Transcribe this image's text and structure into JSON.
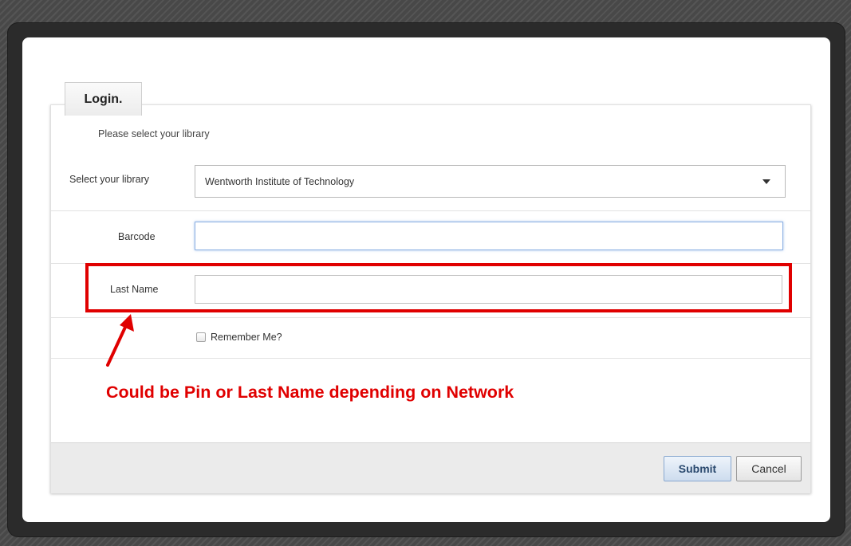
{
  "login_tab": {
    "label": "Login."
  },
  "form": {
    "subtitle": "Please select your library",
    "library": {
      "label": "Select your library",
      "selected": "Wentworth Institute of Technology"
    },
    "barcode": {
      "label": "Barcode",
      "value": ""
    },
    "last_name": {
      "label": "Last Name",
      "value": ""
    },
    "remember": {
      "label": "Remember Me?",
      "checked": false
    }
  },
  "annotation": {
    "text": "Could be Pin or Last Name depending on Network",
    "color": "#e00000"
  },
  "buttons": {
    "submit": "Submit",
    "cancel": "Cancel"
  }
}
